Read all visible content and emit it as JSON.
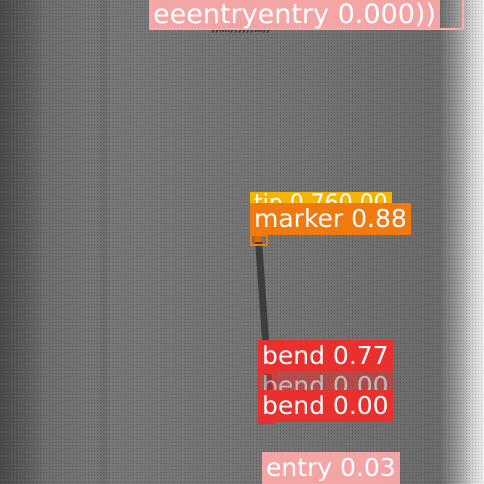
{
  "detections": {
    "entry_top": "eeentryentry 0.000))",
    "tip": "tip 0.760.00",
    "marker": "marker 0.88",
    "bend_1": "bend 0.77",
    "bend_2": "bend 0.00",
    "bend_3": "bend 0.00",
    "entry_bottom": "entry 0.03"
  },
  "colors": {
    "entry": "#ffaaaa",
    "marker": "#f07a10",
    "tip": "#f4b400",
    "bend": "#e8302e"
  }
}
